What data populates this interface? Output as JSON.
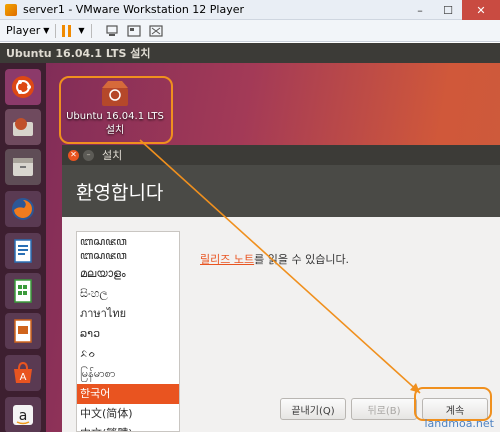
{
  "window": {
    "title": "server1 - VMware Workstation 12 Player"
  },
  "toolbar": {
    "player_label": "Player"
  },
  "ubuntu_bar": {
    "title": "Ubuntu 16.04.1 LTS 설치"
  },
  "desktop_icon": {
    "line1": "Ubuntu 16.04.1 LTS",
    "line2": "설치"
  },
  "installer": {
    "title": "설치",
    "header": "환영합니다",
    "languages": [
      "ꦧꦱꦗꦮ",
      "ꦧꦱꦗꦮ",
      "മലയാളം",
      "සිංහල",
      "ภาษาไทย",
      "ລາວ",
      "ᨅᨔ",
      "မြန်မာစာ",
      "한국어",
      "中文(简体)",
      "中文(繁體)"
    ],
    "selected_language": "한국어",
    "release_link": "릴리즈 노트",
    "release_rest": "를 읽을 수 있습니다.",
    "buttons": {
      "quit": "끝내기(Q)",
      "back": "뒤로(B)",
      "continue": "계속"
    }
  },
  "watermark": "landmoa.net",
  "colors": {
    "accent": "#e95420",
    "highlight": "#f0901e",
    "header": "#4a4a46"
  }
}
